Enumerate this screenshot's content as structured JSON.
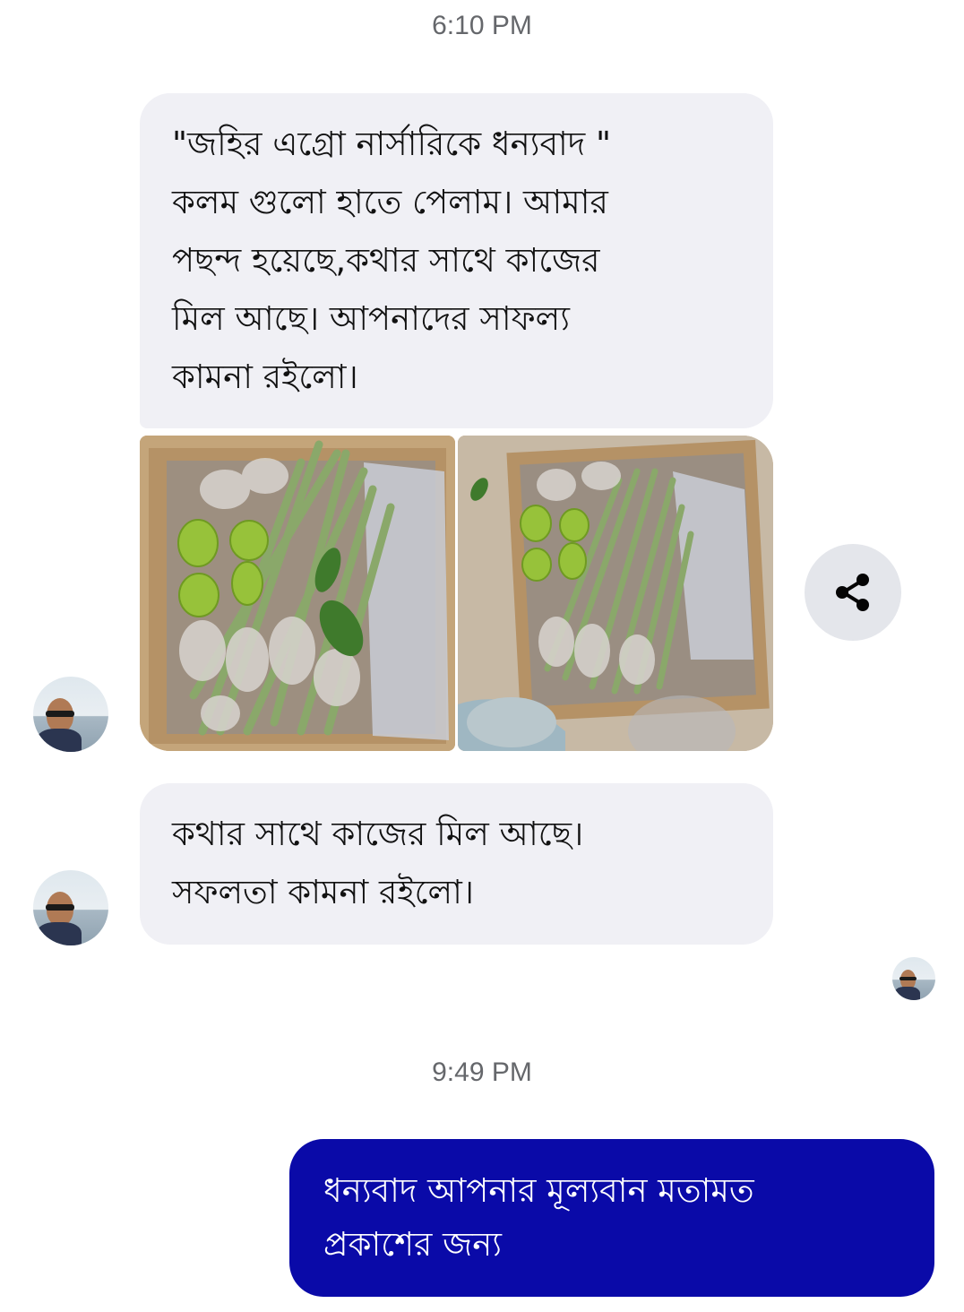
{
  "chat": {
    "timestamps": [
      "6:10 PM",
      "9:49 PM"
    ],
    "incoming_messages": [
      "\"জহির এগ্রো নার্সারিকে ধন্যবাদ \"\nকলম গুলো হাতে পেলাম। আমার\nপছন্দ হয়েছে,কথার সাথে কাজের\nমিল আছে।  আপনাদের সাফল্য\nকামনা রইলো।",
      "কথার সাথে কাজের মিল আছে।\nসফলতা কামনা রইলো।"
    ],
    "outgoing_messages": [
      "ধন্যবাদ আপনার মূল্যবান মতামত\nপ্রকাশের জন্য"
    ],
    "photos": [
      "photo-saplings-box-1",
      "photo-saplings-box-2"
    ],
    "share_icon": "share-icon",
    "colors": {
      "incoming_bubble": "#f0f0f5",
      "outgoing_bubble": "#0a0aa8",
      "timestamp_text": "#65676b",
      "share_button_bg": "#e4e6eb"
    }
  }
}
